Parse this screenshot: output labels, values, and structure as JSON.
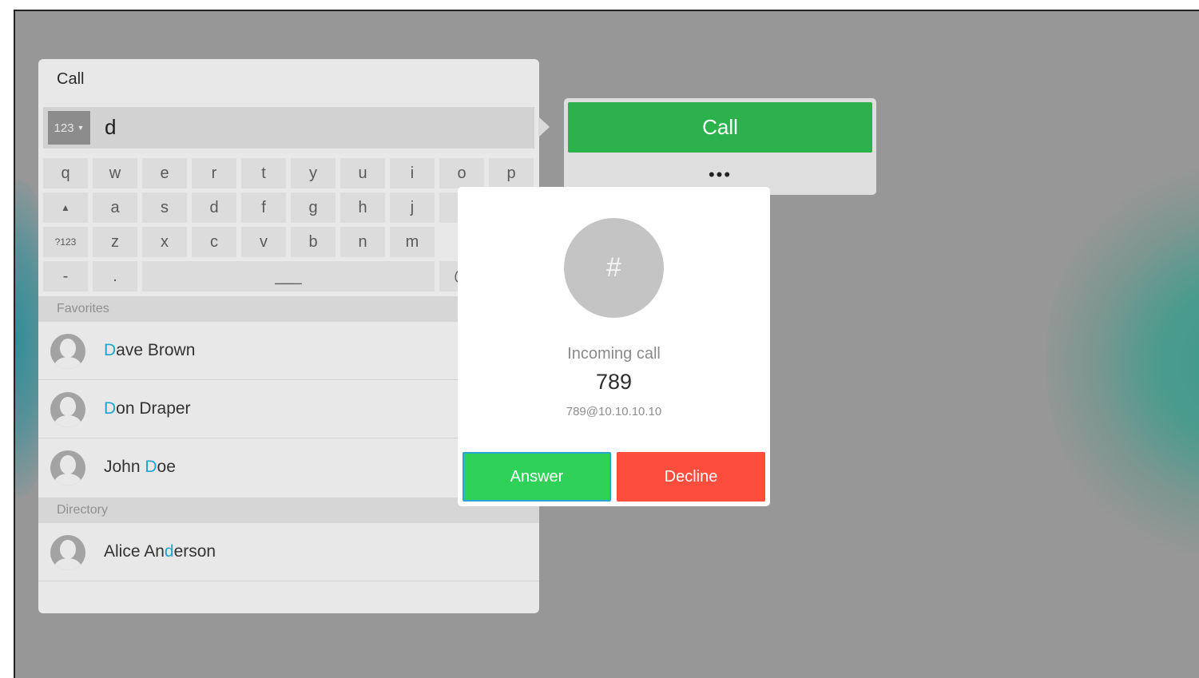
{
  "colors": {
    "background": "#979797",
    "call_green": "#2bb24c",
    "answer_green": "#30d158",
    "decline_red": "#fd4d3c",
    "highlight_blue": "#1ea4d0"
  },
  "call_panel": {
    "title": "Call",
    "keyboard_toggle": "123",
    "keyboard_toggle_icon": "caret-down-icon",
    "input_value": "d",
    "keyboard": {
      "row1": [
        "q",
        "w",
        "e",
        "r",
        "t",
        "y",
        "u",
        "i",
        "o",
        "p"
      ],
      "row2_shift_icon": "shift-arrow-icon",
      "row2_shift": "▲",
      "row2": [
        "a",
        "s",
        "d",
        "f",
        "g",
        "h",
        "j",
        "k"
      ],
      "row3_mode": "?123",
      "row3": [
        "z",
        "x",
        "c",
        "v",
        "b",
        "n",
        "m"
      ],
      "row4_dash": "-",
      "row4_dot": ".",
      "row4_space": "___",
      "row4_at": "@"
    },
    "favorites_header": "Favorites",
    "favorites": [
      {
        "pre": "",
        "match": "D",
        "post": "ave Brown"
      },
      {
        "pre": "",
        "match": "D",
        "post": "on Draper"
      },
      {
        "pre": "John ",
        "match": "D",
        "post": "oe"
      }
    ],
    "directory_header": "Directory",
    "directory": [
      {
        "pre": "Alice An",
        "match": "d",
        "post": "erson"
      }
    ]
  },
  "call_box": {
    "call_label": "Call",
    "more_label": "•••",
    "more_icon": "more-options-icon"
  },
  "incoming_call": {
    "avatar_symbol": "#",
    "label": "Incoming call",
    "number": "789",
    "uri": "789@10.10.10.10",
    "answer_label": "Answer",
    "decline_label": "Decline"
  }
}
